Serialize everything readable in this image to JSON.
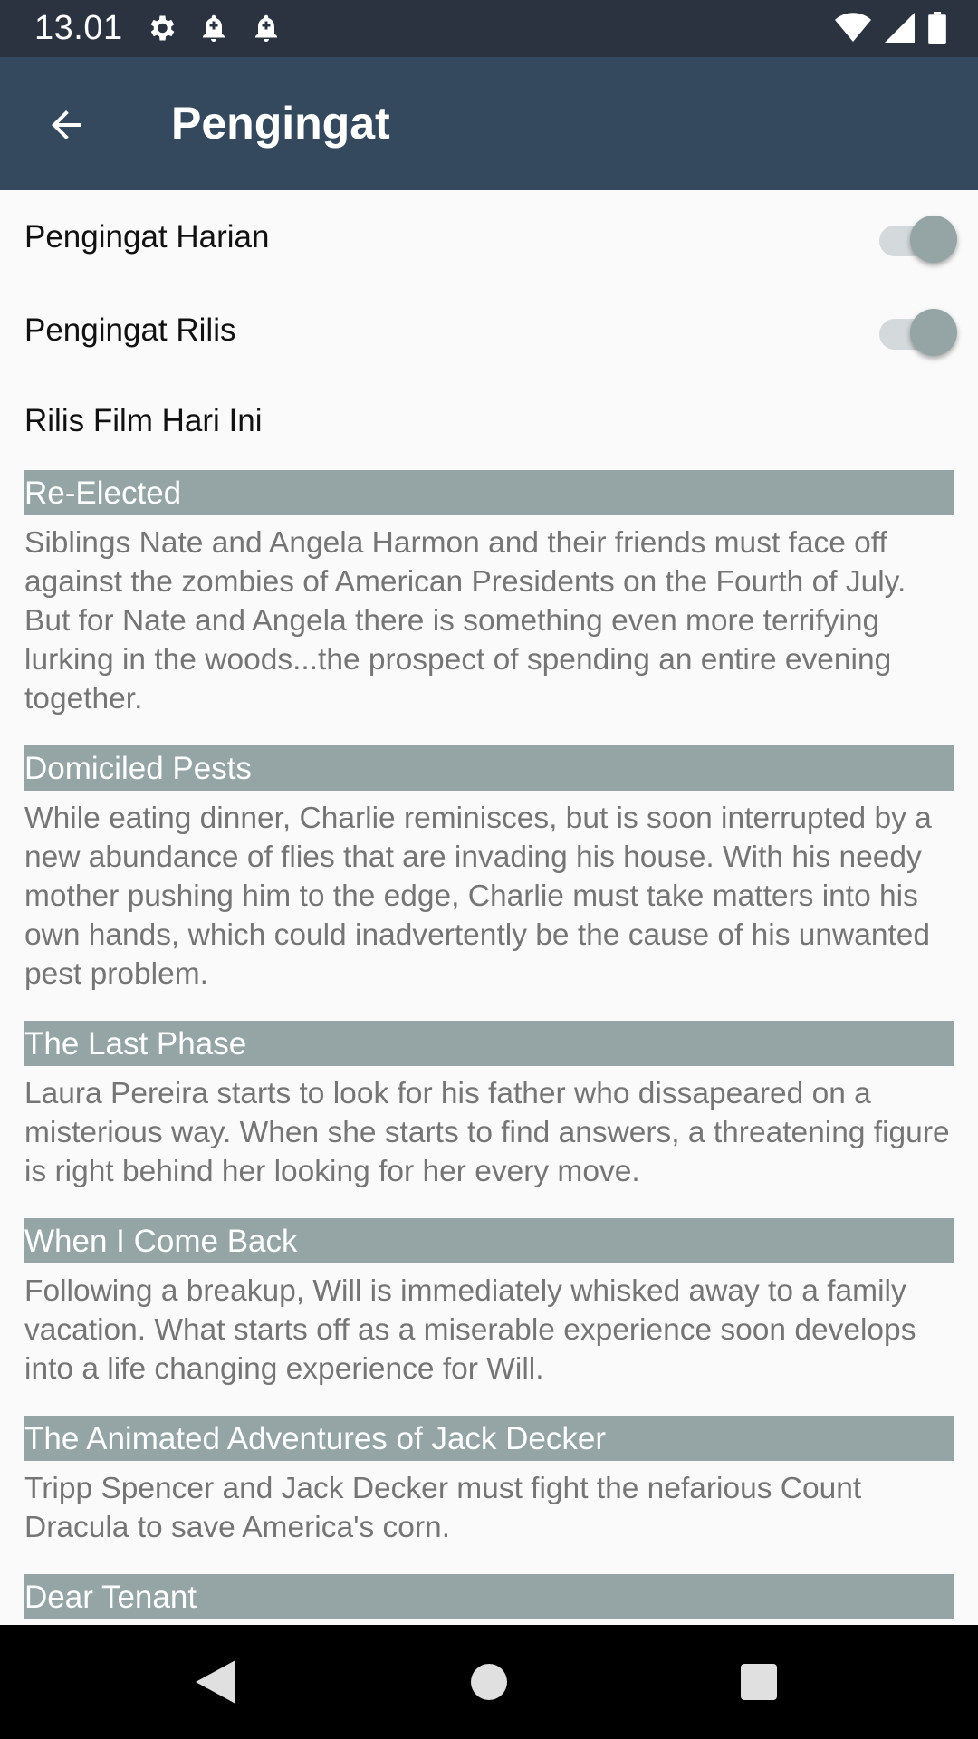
{
  "status_bar": {
    "time": "13.01",
    "left_icons": [
      "gear-icon",
      "notification-bell-icon",
      "notification-bell-icon"
    ],
    "right_icons": [
      "wifi-icon",
      "signal-icon",
      "battery-icon"
    ]
  },
  "app_bar": {
    "title": "Pengingat",
    "background_color": "#34495e"
  },
  "settings": {
    "daily_reminder_label": "Pengingat Harian",
    "release_reminder_label": "Pengingat Rilis",
    "switch_color": "#95a5a6"
  },
  "section": {
    "label": "Rilis Film Hari Ini"
  },
  "movies": [
    {
      "title": "Re-Elected",
      "overview": "Siblings Nate and Angela Harmon and their friends must face off against the zombies of American Presidents on the Fourth of July. But for Nate and Angela there is something even more terrifying lurking in the woods...the prospect of spending an entire evening together."
    },
    {
      "title": "Domiciled Pests",
      "overview": "While eating dinner, Charlie reminisces, but is soon interrupted by a new abundance of flies that are invading his house. With his needy mother pushing him to the edge, Charlie must take matters into his own hands, which could inadvertently be the cause of his unwanted pest problem."
    },
    {
      "title": "The Last Phase",
      "overview": "Laura Pereira starts to look for his father who dissapeared on a misterious way. When she starts to find answers, a threatening figure is right behind her looking for her every move."
    },
    {
      "title": "When I Come Back",
      "overview": "Following a breakup, Will is immediately whisked away to a family vacation. What starts off as a miserable experience soon develops into a life changing experience for Will."
    },
    {
      "title": "The Animated Adventures of Jack Decker",
      "overview": "Tripp Spencer and Jack Decker must fight the nefarious Count Dracula to save America's corn."
    },
    {
      "title": "Dear Tenant",
      "overview": ""
    }
  ],
  "nav_bar": {
    "icons": [
      "back-triangle-icon",
      "home-circle-icon",
      "recents-square-icon"
    ]
  }
}
